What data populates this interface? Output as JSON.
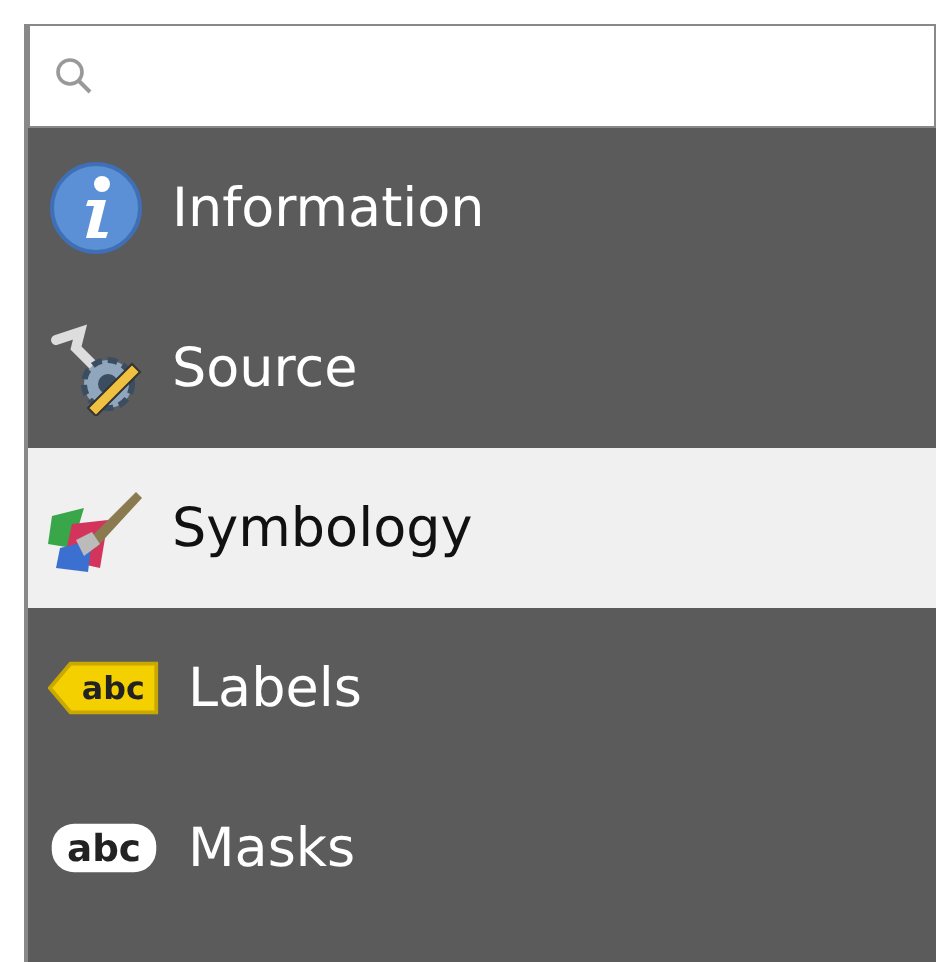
{
  "items": [
    {
      "label": "Information",
      "kind": "info",
      "selected": false
    },
    {
      "label": "Source",
      "kind": "source",
      "selected": false
    },
    {
      "label": "Symbology",
      "kind": "symbology",
      "selected": true
    },
    {
      "label": "Labels",
      "kind": "labels",
      "icon_text": "abc",
      "selected": false
    },
    {
      "label": "Masks",
      "kind": "masks",
      "icon_text": "abc",
      "selected": false
    }
  ]
}
